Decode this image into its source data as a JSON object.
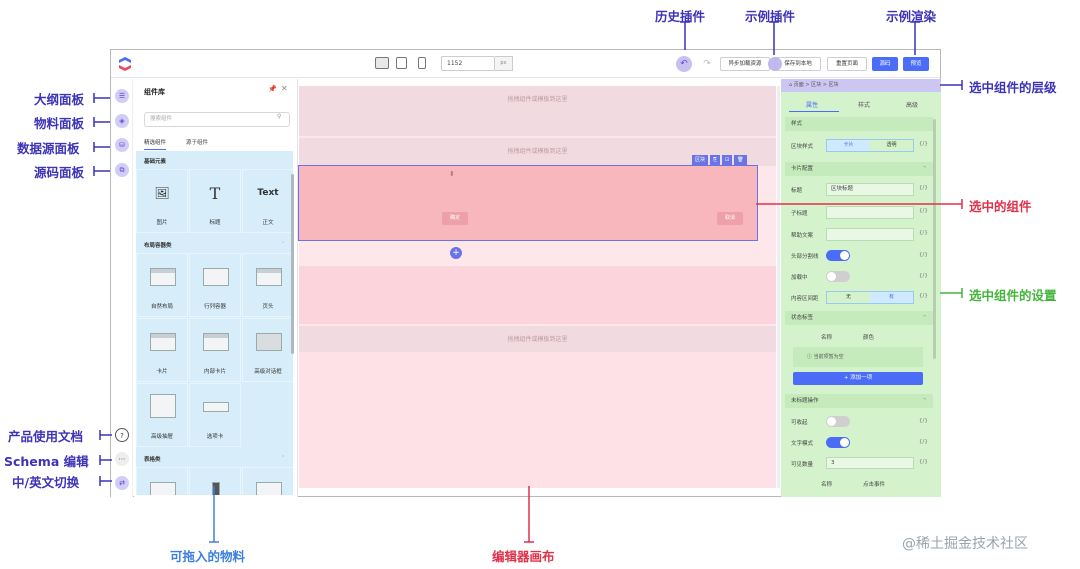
{
  "topbar": {
    "width_value": "1152",
    "width_unit": "px",
    "async_load_label": "异步加载资源",
    "save_local_label": "保存到本地",
    "reset_page_label": "重置页面",
    "source_label": "源码",
    "preview_label": "预览",
    "undo_icon": "↶",
    "redo_icon": "↷"
  },
  "component_panel": {
    "title": "组件库",
    "search_placeholder": "搜索组件",
    "tabs": [
      "精选组件",
      "源于组件"
    ],
    "groups": [
      {
        "title": "基础元素",
        "items": [
          {
            "label": "图片",
            "icon": "▲"
          },
          {
            "label": "标题",
            "icon": "T"
          },
          {
            "label": "正文",
            "icon": "Text"
          }
        ]
      },
      {
        "title": "布局容器类",
        "items": [
          {
            "label": "自然布局"
          },
          {
            "label": "行列容器"
          },
          {
            "label": "页头"
          },
          {
            "label": "卡片"
          },
          {
            "label": "内部卡片"
          },
          {
            "label": "高级对话框"
          },
          {
            "label": "高级抽屉"
          },
          {
            "label": "选项卡"
          }
        ]
      },
      {
        "title": "表格类",
        "items": []
      }
    ]
  },
  "canvas": {
    "drop_hint": "拖拽组件或模板到这里",
    "selected_toolbar": [
      "区块",
      "⎘",
      "⊡",
      "🗑"
    ],
    "selected_buttons": [
      "确定",
      "取消"
    ],
    "add_icon": "+"
  },
  "settings": {
    "breadcrumb": "⌂  页面  >  区块  >  区块",
    "tabs": [
      "属性",
      "样式",
      "高级"
    ],
    "style_section": "样式",
    "block_style_label": "区块样式",
    "block_style_options": [
      "卡片",
      "透明"
    ],
    "card_section": "卡片配置",
    "title_label": "标题",
    "title_value": "区块标题",
    "subtitle_label": "子标题",
    "help_label": "帮助文案",
    "header_divider_label": "头部分割线",
    "loading_label": "加载中",
    "padding_label": "内容区间距",
    "padding_options": [
      "无",
      "有"
    ],
    "state_section": "状态标签",
    "state_cols": [
      "名称",
      "颜色"
    ],
    "empty_text": "ⓘ 当前项暂为空",
    "add_one_label": "+ 添加一项",
    "actions_section": "未标题操作",
    "collapsible_label": "可收起",
    "text_mode_label": "文字模式",
    "visible_count_label": "可见数量",
    "visible_count_value": "3",
    "action_cols": [
      "名称",
      "点击事件"
    ],
    "var_icon": "{/}"
  },
  "annotations": {
    "history_plugin": "历史插件",
    "sample_plugin": "示例插件",
    "sample_render": "示例渲染",
    "outline_panel": "大纲面板",
    "material_panel": "物料面板",
    "datasource_panel": "数据源面板",
    "code_panel": "源码面板",
    "product_docs": "产品使用文档",
    "schema_edit": "Schema 编辑",
    "lang_switch": "中/英文切换",
    "selected_hierarchy": "选中组件的层级",
    "selected_component": "选中的组件",
    "selected_settings": "选中组件的设置",
    "draggable_materials": "可拖入的物料",
    "editor_canvas": "编辑器画布"
  },
  "watermark": "@稀土掘金技术社区",
  "colors": {
    "accent": "#4a6cf7",
    "annotation_purple": "#3c33b8",
    "annotation_red": "#e0304a",
    "annotation_green": "#43b43b",
    "annotation_blue": "#3d7fe0"
  }
}
